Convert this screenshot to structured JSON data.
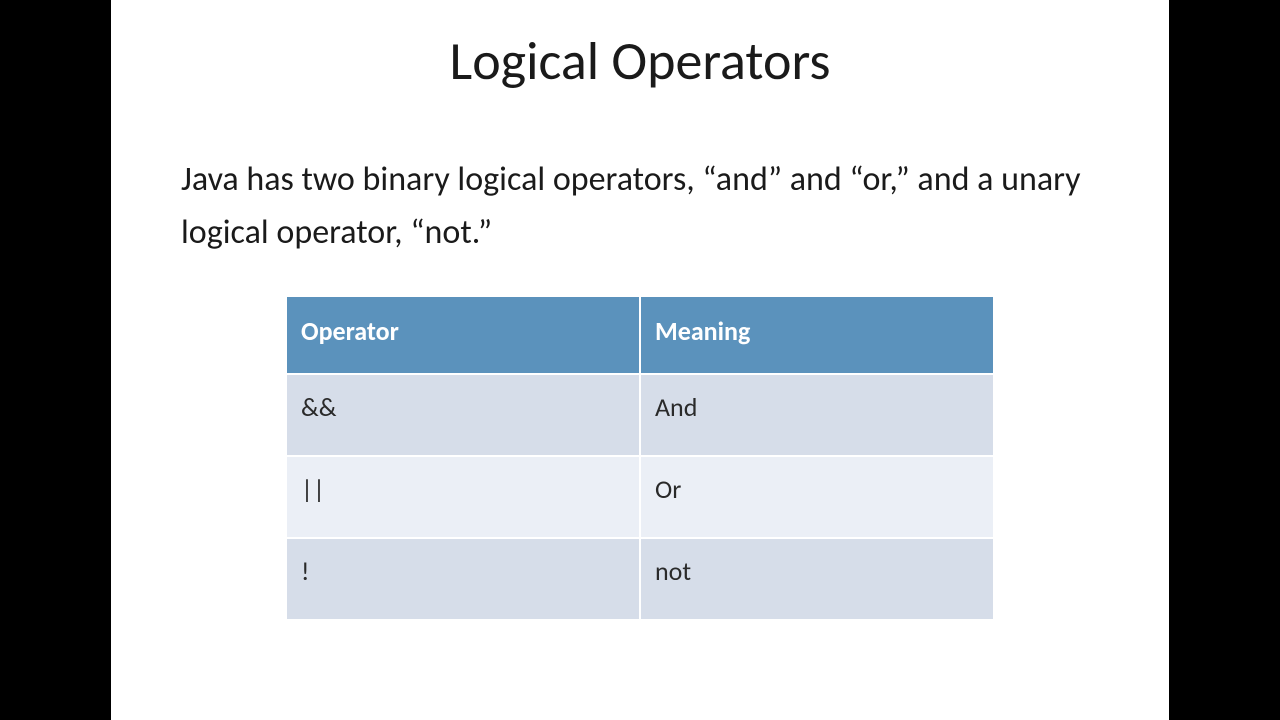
{
  "slide": {
    "title": "Logical Operators",
    "body": "Java has two binary logical operators, “and” and “or,” and a unary logical operator, “not.”",
    "table": {
      "headers": [
        "Operator",
        "Meaning"
      ],
      "rows": [
        {
          "operator": "&&",
          "meaning": "And"
        },
        {
          "operator": "||",
          "meaning": "Or"
        },
        {
          "operator": "!",
          "meaning": "not"
        }
      ]
    }
  }
}
